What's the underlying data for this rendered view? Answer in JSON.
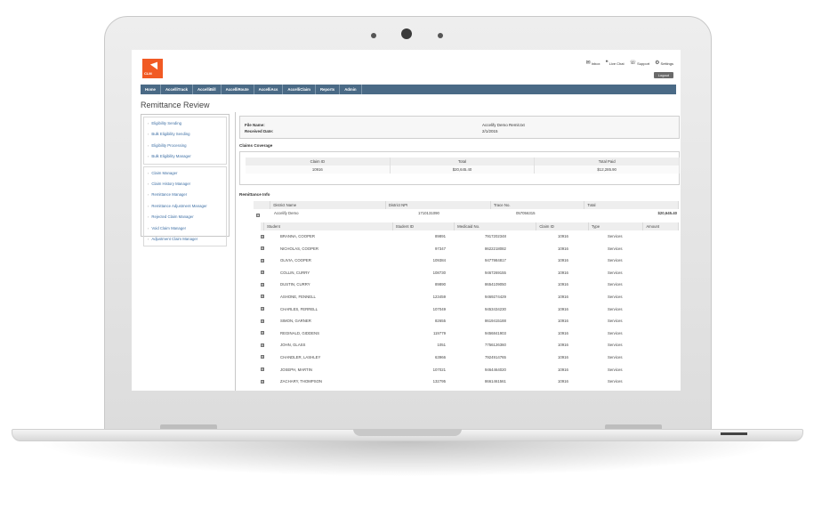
{
  "logo": {
    "text": "CLM"
  },
  "top_links": [
    {
      "icon": "mail-icon",
      "glyph": "✉",
      "label": "Inbox"
    },
    {
      "icon": "chat-icon",
      "glyph": "❝",
      "label": "Live Chat"
    },
    {
      "icon": "support-icon",
      "glyph": "☏",
      "label": "Support"
    },
    {
      "icon": "gear-icon",
      "glyph": "⚙",
      "label": "Settings"
    }
  ],
  "logout_label": "Logout",
  "nav": [
    "Home",
    "AccelliTrack",
    "AccelliBill",
    "AccelliRoute",
    "AccelliAcs",
    "AccelliClaim",
    "Reports",
    "Admin"
  ],
  "page_title": "Remittance Review",
  "sidebar": {
    "group1": [
      "Eligibility Sending",
      "Bulk Eligibility Sending",
      "Eligibility Processing",
      "Bulk Eligibility Manager"
    ],
    "group2": [
      "Claim Manager",
      "Claim History Manager",
      "Remittance Manager",
      "Remittance Adjustment Manager",
      "Rejected Claim Manager",
      "Void Claim Manager",
      "Adjustment Claim Manager"
    ]
  },
  "file": {
    "name_label": "File Name:",
    "received_label": "Received Date:",
    "name_value": "Accelify Demo Remit.txt",
    "received_value": "2/1/2015"
  },
  "claims_coverage": {
    "title": "Claims Coverage",
    "headers": [
      "Claim ID",
      "Total",
      "Total Paid"
    ],
    "values": [
      "10916",
      "$20,645.40",
      "$12,285.90"
    ]
  },
  "remittance": {
    "title": "Remittance Info",
    "district_headers": [
      "District Name",
      "District NPI",
      "Trace No.",
      "Total"
    ],
    "district": {
      "expander": "⊟",
      "name": "Accelify Demo",
      "npi": "1710131090",
      "trace": "057056315",
      "total": "$20,645.40"
    },
    "student_headers": [
      "Student",
      "Student ID",
      "Medicaid No.",
      "Claim ID",
      "Type",
      "Amount"
    ],
    "students": [
      {
        "name": "BRANNA, COOPER",
        "id": "89891",
        "medicaid": "7917202348",
        "claim": "10916",
        "type": "Services"
      },
      {
        "name": "NICHOLAS, COOPER",
        "id": "97347",
        "medicaid": "8622218082",
        "claim": "10916",
        "type": "Services"
      },
      {
        "name": "OLIVIA, COOPER",
        "id": "109384",
        "medicaid": "9477984817",
        "claim": "10916",
        "type": "Services"
      },
      {
        "name": "COLLIN, CURRY",
        "id": "108730",
        "medicaid": "9467269155",
        "claim": "10916",
        "type": "Services"
      },
      {
        "name": "DUSTIN, CURRY",
        "id": "89890",
        "medicaid": "8654109050",
        "claim": "10916",
        "type": "Services"
      },
      {
        "name": "ASHONE, FENNELL",
        "id": "123459",
        "medicaid": "9469274429",
        "claim": "10916",
        "type": "Services"
      },
      {
        "name": "CHARLES, FERRELL",
        "id": "107049",
        "medicaid": "9453434230",
        "claim": "10916",
        "type": "Services"
      },
      {
        "name": "SIMON, GARNER",
        "id": "82655",
        "medicaid": "8619415188",
        "claim": "10916",
        "type": "Services"
      },
      {
        "name": "REGINALD, GIDDENS",
        "id": "119779",
        "medicaid": "9456841903",
        "claim": "10916",
        "type": "Services"
      },
      {
        "name": "JOHN, GLASS",
        "id": "1051",
        "medicaid": "7756126360",
        "claim": "10916",
        "type": "Services"
      },
      {
        "name": "CHANDLER, LASHLEY",
        "id": "63966",
        "medicaid": "7924914765",
        "claim": "10916",
        "type": "Services"
      },
      {
        "name": "JOSEPH, MARTIN",
        "id": "107021",
        "medicaid": "9464464020",
        "claim": "10916",
        "type": "Services"
      },
      {
        "name": "ZACHARY, THOMPSON",
        "id": "132795",
        "medicaid": "8661461561",
        "claim": "10916",
        "type": "Services"
      }
    ]
  },
  "colors": {
    "nav_bar": "#4a6a86",
    "logo_bg": "#f15a24",
    "link": "#3e6fa4"
  }
}
